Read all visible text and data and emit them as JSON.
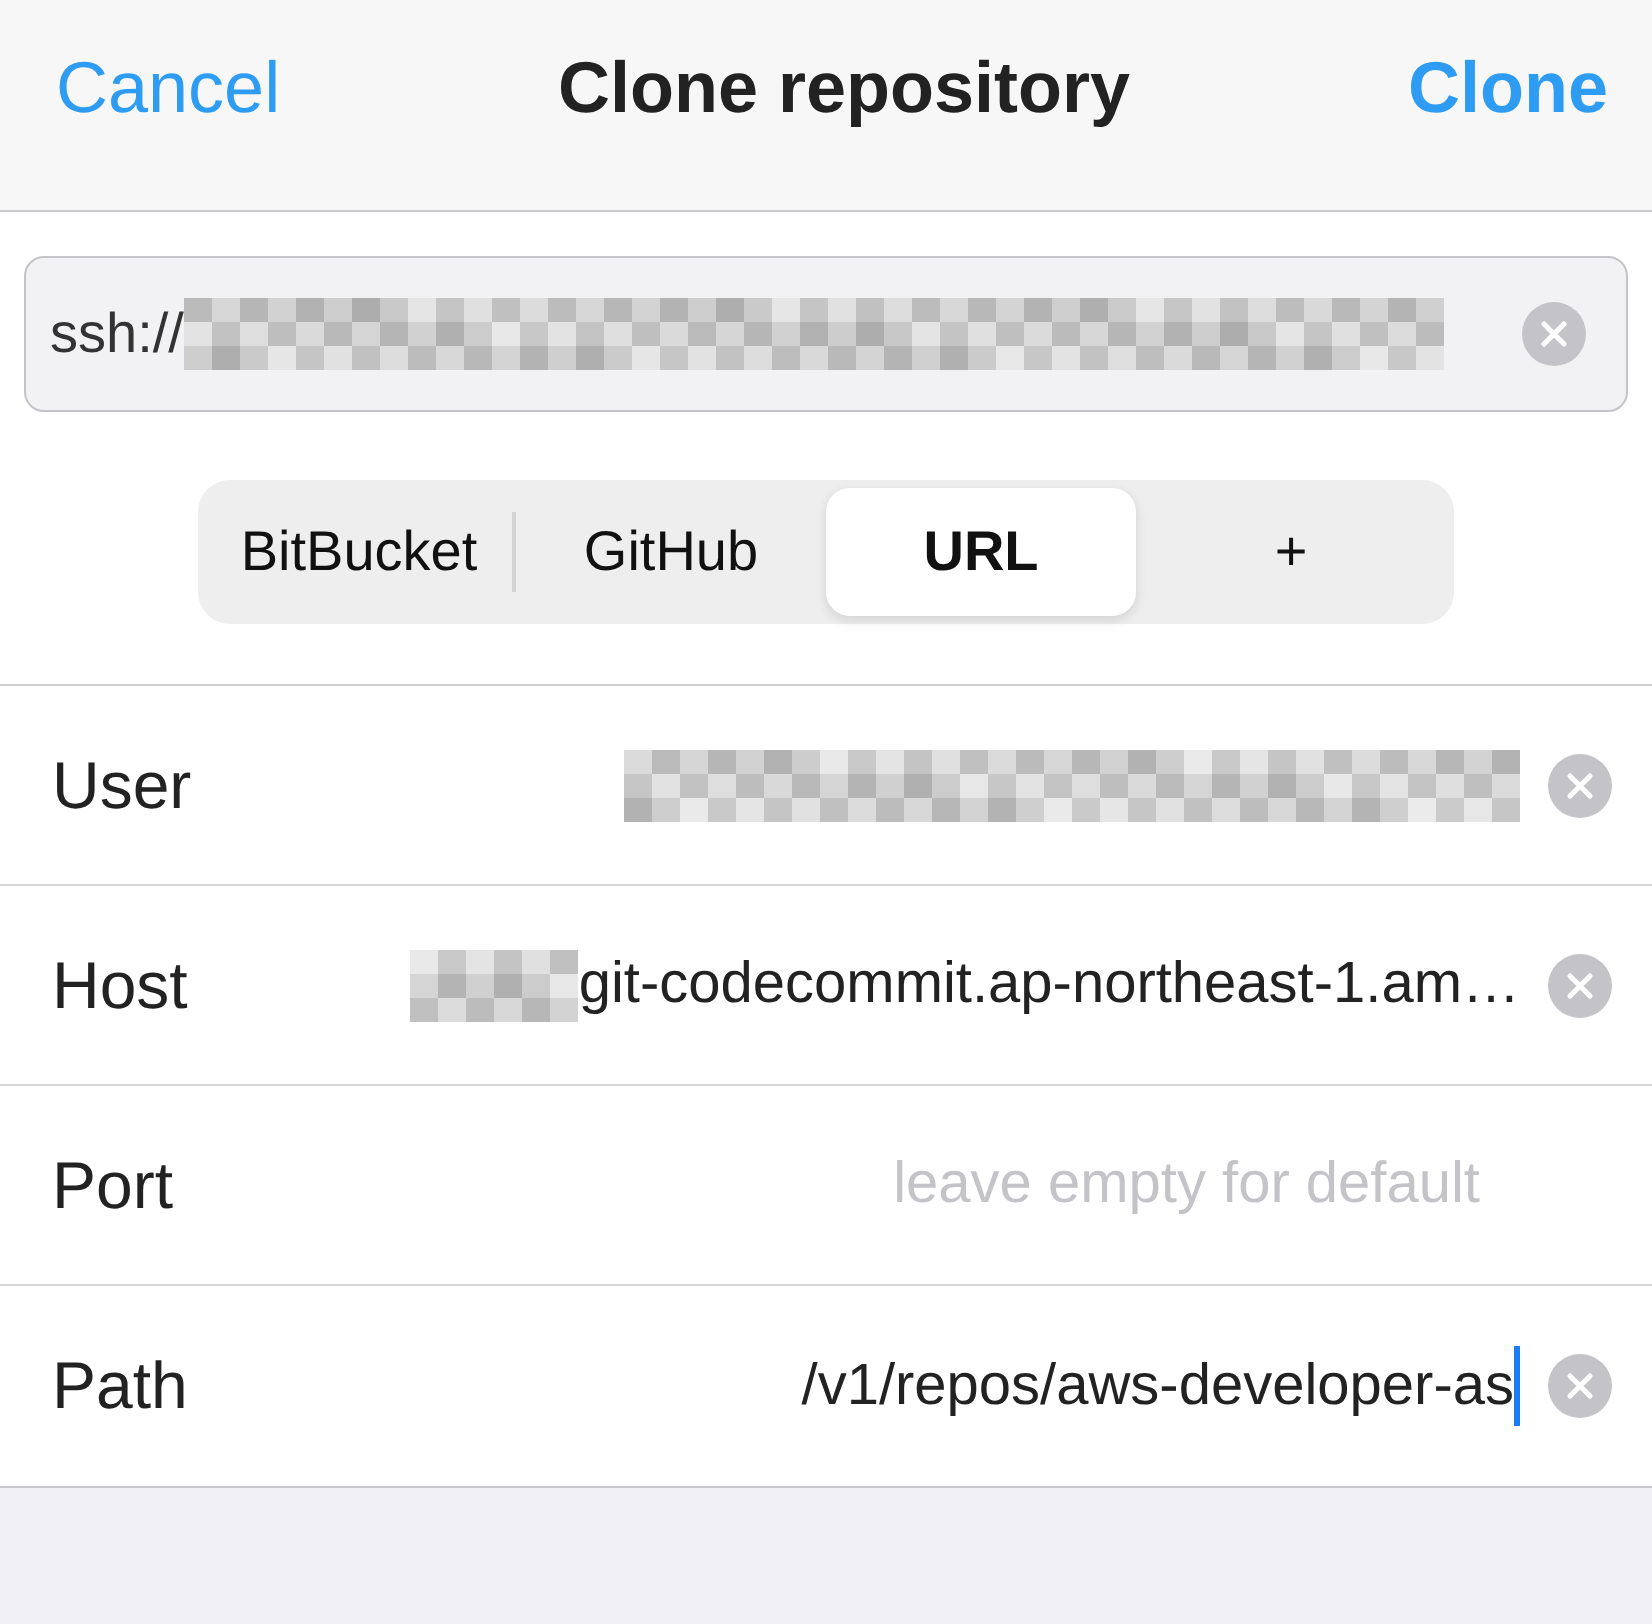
{
  "header": {
    "cancel": "Cancel",
    "title": "Clone repository",
    "confirm": "Clone"
  },
  "url_field": {
    "value": "ssh://",
    "redacted": true,
    "clearable": true
  },
  "segments": [
    {
      "label": "BitBucket",
      "selected": false
    },
    {
      "label": "GitHub",
      "selected": false
    },
    {
      "label": "URL",
      "selected": true
    },
    {
      "label": "+",
      "selected": false
    }
  ],
  "rows": [
    {
      "label": "User",
      "redacted": true,
      "clearable": true
    },
    {
      "label": "Host",
      "value": "git-codecommit.ap-northeast-1.am…",
      "redacted": true,
      "clearable": true
    },
    {
      "label": "Port",
      "placeholder": "leave empty for default",
      "clearable": false
    },
    {
      "label": "Path",
      "value": "/v1/repos/aws-developer-as",
      "focused": true,
      "clearable": true
    }
  ]
}
